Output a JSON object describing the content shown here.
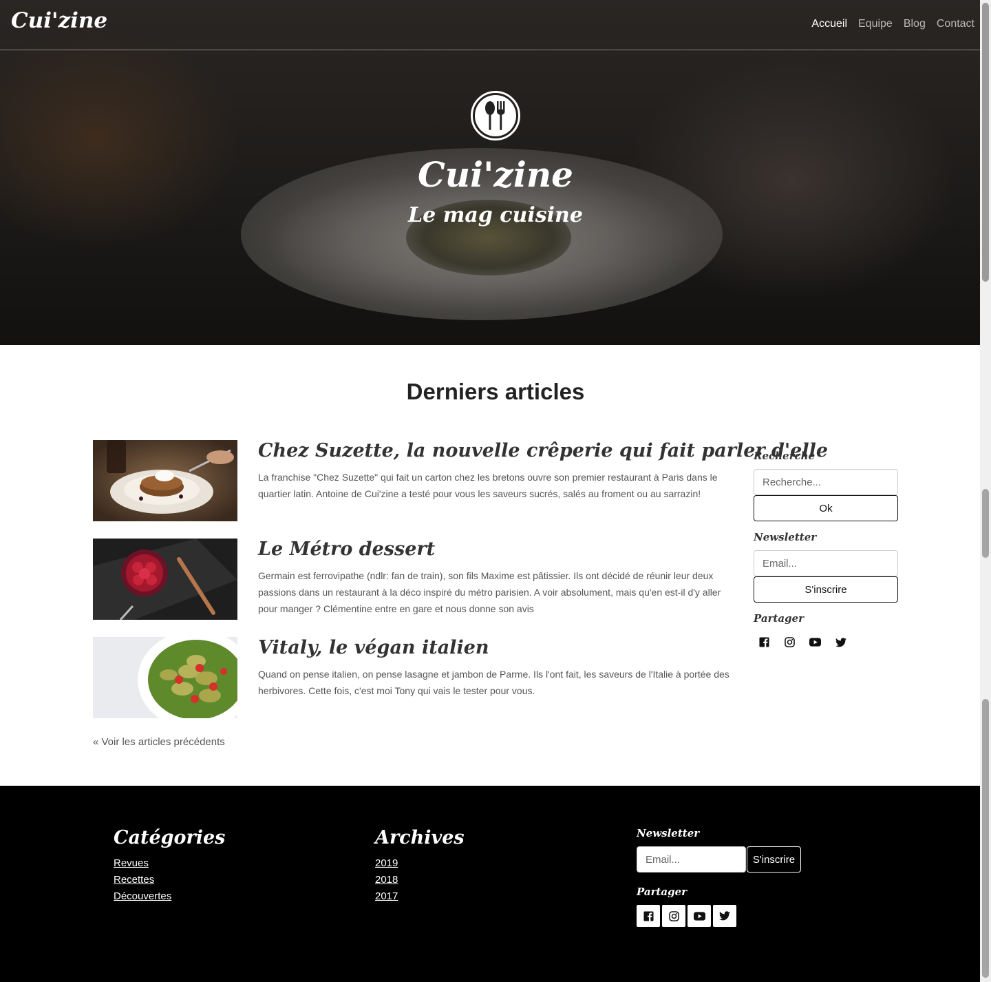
{
  "header": {
    "brand": "Cui'zine",
    "nav": [
      {
        "label": "Accueil",
        "active": true
      },
      {
        "label": "Equipe",
        "active": false
      },
      {
        "label": "Blog",
        "active": false
      },
      {
        "label": "Contact",
        "active": false
      }
    ]
  },
  "hero": {
    "logo_icon": "spoon-fork-icon",
    "title": "Cui'zine",
    "subtitle": "Le mag cuisine"
  },
  "main": {
    "section_title": "Derniers articles",
    "articles": [
      {
        "title": "Chez Suzette, la nouvelle crêperie qui fait parler d'elle",
        "text": "La franchise \"Chez Suzette\" qui fait un carton chez les bretons ouvre son premier restaurant à Paris dans le quartier latin. Antoine de Cui'zine a testé pour vous les saveurs sucrés, salés au froment ou au sarrazin!",
        "image": "crepes-photo"
      },
      {
        "title": "Le Métro dessert",
        "text": "Germain est ferrovipathe (ndlr: fan de train), son fils Maxime est pâtissier. Ils ont décidé de réunir leur deux passions dans un restaurant à la déco inspiré du métro parisien. A voir absolument, mais qu'en est-il d'y aller pour manger ? Clémentine entre en gare et nous donne son avis",
        "image": "raspberry-dessert-photo"
      },
      {
        "title": "Vitaly, le végan italien",
        "text": "Quand on pense italien, on pense lasagne et jambon de Parme. Ils l'ont fait, les saveurs de l'Italie à portée des herbivores. Cette fois, c'est moi Tony qui vais le tester pour vous.",
        "image": "pasta-salad-photo"
      }
    ],
    "prev_link": "« Voir les articles précédents"
  },
  "sidebar": {
    "search_label": "Recherche",
    "search_placeholder": "Recherche...",
    "search_button": "Ok",
    "newsletter_label": "Newsletter",
    "email_placeholder": "Email...",
    "subscribe_button": "S'inscrire",
    "share_label": "Partager",
    "share_icons": [
      "facebook-icon",
      "instagram-icon",
      "youtube-icon",
      "twitter-icon"
    ]
  },
  "footer": {
    "categories_title": "Catégories",
    "categories": [
      "Revues",
      "Recettes",
      "Découvertes"
    ],
    "archives_title": "Archives",
    "archives": [
      "2019",
      "2018",
      "2017"
    ],
    "newsletter_label": "Newsletter",
    "email_placeholder": "Email...",
    "subscribe_button": "S'inscrire",
    "share_label": "Partager",
    "share_icons": [
      "facebook-icon",
      "instagram-icon",
      "youtube-icon",
      "twitter-icon"
    ]
  }
}
